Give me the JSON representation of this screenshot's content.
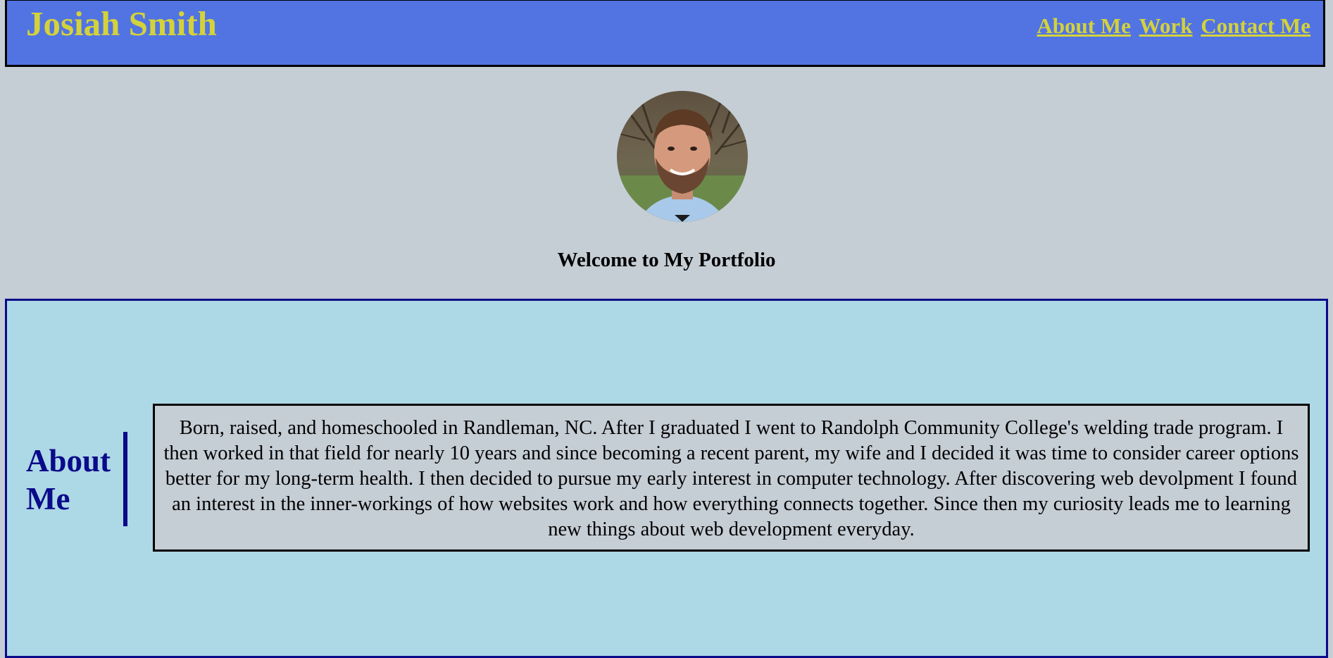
{
  "header": {
    "site_name": "Josiah Smith",
    "nav": [
      {
        "label": "About Me"
      },
      {
        "label": "Work"
      },
      {
        "label": "Contact Me"
      }
    ]
  },
  "hero": {
    "welcome": "Welcome to My Portfolio"
  },
  "about": {
    "title": "About Me",
    "bio": "Born, raised, and homeschooled in Randleman, NC. After I graduated I went to Randolph Community College's welding trade program. I then worked in that field for nearly 10 years and since becoming a recent parent, my wife and I decided it was time to consider career options better for my long-term health. I then decided to pursue my early interest in computer technology. After discovering web devolpment I found an interest in the inner-workings of how websites work and how everything connects together. Since then my curiosity leads me to learning new things about web development everyday."
  },
  "colors": {
    "header_bg": "#5174e2",
    "accent_yellow": "#d4d23a",
    "page_bg": "#c5cdd5",
    "about_bg": "#add8e6",
    "navy": "#0a0a8a"
  }
}
